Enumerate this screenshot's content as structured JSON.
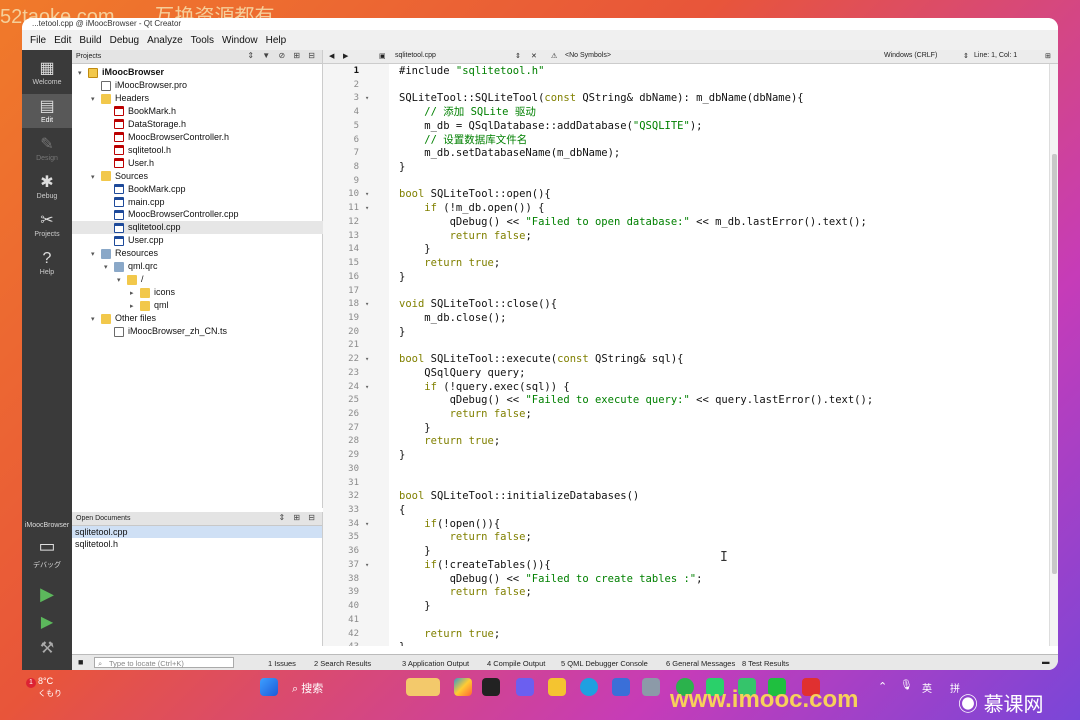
{
  "overlay": {
    "site_text": "52taoke.com",
    "site_text_zh": "互换资源都有",
    "bottom_brand": "www.imooc.com",
    "bottom_brand_zh": "慕课网"
  },
  "window": {
    "title": "...tetool.cpp @ iMoocBrowser - Qt Creator"
  },
  "menubar": {
    "items": [
      "File",
      "Edit",
      "Build",
      "Debug",
      "Analyze",
      "Tools",
      "Window",
      "Help"
    ]
  },
  "modebar": {
    "items": [
      {
        "label": "Welcome",
        "icon": "grid-icon"
      },
      {
        "label": "Edit",
        "icon": "document-icon"
      },
      {
        "label": "Design",
        "icon": "pencil-icon"
      },
      {
        "label": "Debug",
        "icon": "bug-icon"
      },
      {
        "label": "Projects",
        "icon": "wrench-icon"
      },
      {
        "label": "Help",
        "icon": "help-icon"
      }
    ],
    "kit_label": "iMoocBrowser",
    "kit_sub": "デバッグ"
  },
  "projects": {
    "header": "Projects",
    "tree": [
      {
        "label": "iMoocBrowser",
        "depth": 0,
        "icon": "proj",
        "arrow": "▾",
        "bold": true
      },
      {
        "label": "iMoocBrowser.pro",
        "depth": 1,
        "icon": "pro",
        "arrow": ""
      },
      {
        "label": "Headers",
        "depth": 1,
        "icon": "folder",
        "arrow": "▾"
      },
      {
        "label": "BookMark.h",
        "depth": 2,
        "icon": "h",
        "arrow": ""
      },
      {
        "label": "DataStorage.h",
        "depth": 2,
        "icon": "h",
        "arrow": ""
      },
      {
        "label": "MoocBrowserController.h",
        "depth": 2,
        "icon": "h",
        "arrow": ""
      },
      {
        "label": "sqlitetool.h",
        "depth": 2,
        "icon": "h",
        "arrow": ""
      },
      {
        "label": "User.h",
        "depth": 2,
        "icon": "h",
        "arrow": ""
      },
      {
        "label": "Sources",
        "depth": 1,
        "icon": "folder",
        "arrow": "▾"
      },
      {
        "label": "BookMark.cpp",
        "depth": 2,
        "icon": "cpp",
        "arrow": ""
      },
      {
        "label": "main.cpp",
        "depth": 2,
        "icon": "cpp",
        "arrow": ""
      },
      {
        "label": "MoocBrowserController.cpp",
        "depth": 2,
        "icon": "cpp",
        "arrow": ""
      },
      {
        "label": "sqlitetool.cpp",
        "depth": 2,
        "icon": "cpp",
        "arrow": "",
        "selected": true
      },
      {
        "label": "User.cpp",
        "depth": 2,
        "icon": "cpp",
        "arrow": ""
      },
      {
        "label": "Resources",
        "depth": 1,
        "icon": "res",
        "arrow": "▾"
      },
      {
        "label": "qml.qrc",
        "depth": 2,
        "icon": "res",
        "arrow": "▾"
      },
      {
        "label": "/",
        "depth": 3,
        "icon": "folder",
        "arrow": "▾"
      },
      {
        "label": "icons",
        "depth": 4,
        "icon": "folder",
        "arrow": "▸"
      },
      {
        "label": "qml",
        "depth": 4,
        "icon": "folder",
        "arrow": "▸"
      },
      {
        "label": "Other files",
        "depth": 1,
        "icon": "folder",
        "arrow": "▾"
      },
      {
        "label": "iMoocBrowser_zh_CN.ts",
        "depth": 2,
        "icon": "pro",
        "arrow": ""
      }
    ]
  },
  "open_documents": {
    "header": "Open Documents",
    "items": [
      "sqlitetool.cpp",
      "sqlitetool.h"
    ]
  },
  "editor_toolbar": {
    "file": "sqlitetool.cpp",
    "symbols": "<No Symbols>",
    "line_ending": "Windows (CRLF)",
    "position": "Line: 1, Col: 1"
  },
  "code": [
    {
      "n": "1",
      "text": "#include \"sqlitetool.h\"",
      "fold": ""
    },
    {
      "n": "2",
      "text": "",
      "fold": ""
    },
    {
      "n": "3",
      "text": "SQLiteTool::SQLiteTool(const QString& dbName): m_dbName(dbName){",
      "fold": "▾"
    },
    {
      "n": "4",
      "text": "    // 添加 SQLite 驱动",
      "fold": ""
    },
    {
      "n": "5",
      "text": "    m_db = QSqlDatabase::addDatabase(\"QSQLITE\");",
      "fold": ""
    },
    {
      "n": "6",
      "text": "    // 设置数据库文件名",
      "fold": ""
    },
    {
      "n": "7",
      "text": "    m_db.setDatabaseName(m_dbName);",
      "fold": ""
    },
    {
      "n": "8",
      "text": "}",
      "fold": ""
    },
    {
      "n": "9",
      "text": "",
      "fold": ""
    },
    {
      "n": "10",
      "text": "bool SQLiteTool::open(){",
      "fold": "▾"
    },
    {
      "n": "11",
      "text": "    if (!m_db.open()) {",
      "fold": "▾"
    },
    {
      "n": "12",
      "text": "        qDebug() << \"Failed to open database:\" << m_db.lastError().text();",
      "fold": ""
    },
    {
      "n": "13",
      "text": "        return false;",
      "fold": ""
    },
    {
      "n": "14",
      "text": "    }",
      "fold": ""
    },
    {
      "n": "15",
      "text": "    return true;",
      "fold": ""
    },
    {
      "n": "16",
      "text": "}",
      "fold": ""
    },
    {
      "n": "17",
      "text": "",
      "fold": ""
    },
    {
      "n": "18",
      "text": "void SQLiteTool::close(){",
      "fold": "▾"
    },
    {
      "n": "19",
      "text": "    m_db.close();",
      "fold": ""
    },
    {
      "n": "20",
      "text": "}",
      "fold": ""
    },
    {
      "n": "21",
      "text": "",
      "fold": ""
    },
    {
      "n": "22",
      "text": "bool SQLiteTool::execute(const QString& sql){",
      "fold": "▾"
    },
    {
      "n": "23",
      "text": "    QSqlQuery query;",
      "fold": ""
    },
    {
      "n": "24",
      "text": "    if (!query.exec(sql)) {",
      "fold": "▾"
    },
    {
      "n": "25",
      "text": "        qDebug() << \"Failed to execute query:\" << query.lastError().text();",
      "fold": ""
    },
    {
      "n": "26",
      "text": "        return false;",
      "fold": ""
    },
    {
      "n": "27",
      "text": "    }",
      "fold": ""
    },
    {
      "n": "28",
      "text": "    return true;",
      "fold": ""
    },
    {
      "n": "29",
      "text": "}",
      "fold": ""
    },
    {
      "n": "30",
      "text": "",
      "fold": ""
    },
    {
      "n": "31",
      "text": "",
      "fold": ""
    },
    {
      "n": "32",
      "text": "bool SQLiteTool::initializeDatabases()",
      "fold": ""
    },
    {
      "n": "33",
      "text": "{",
      "fold": ""
    },
    {
      "n": "34",
      "text": "    if(!open()){",
      "fold": "▾"
    },
    {
      "n": "35",
      "text": "        return false;",
      "fold": ""
    },
    {
      "n": "36",
      "text": "    }",
      "fold": ""
    },
    {
      "n": "37",
      "text": "    if(!createTables()){",
      "fold": "▾"
    },
    {
      "n": "38",
      "text": "        qDebug() << \"Failed to create tables :\";",
      "fold": ""
    },
    {
      "n": "39",
      "text": "        return false;",
      "fold": ""
    },
    {
      "n": "40",
      "text": "    }",
      "fold": ""
    },
    {
      "n": "41",
      "text": "",
      "fold": ""
    },
    {
      "n": "42",
      "text": "    return true;",
      "fold": ""
    },
    {
      "n": "43",
      "text": "}",
      "fold": ""
    }
  ],
  "statusbar": {
    "locate_placeholder": "Type to locate (Ctrl+K)",
    "tabs": [
      "1 Issues",
      "2 Search Results",
      "3 Application Output",
      "4 Compile Output",
      "5 QML Debugger Console",
      "6 General Messages",
      "8 Test Results"
    ]
  },
  "taskbar": {
    "weather_temp": "8°C",
    "weather_desc": "くもり",
    "weather_badge": "1",
    "search_label": "搜索",
    "ime_label": "英",
    "ime2_label": "拼"
  }
}
